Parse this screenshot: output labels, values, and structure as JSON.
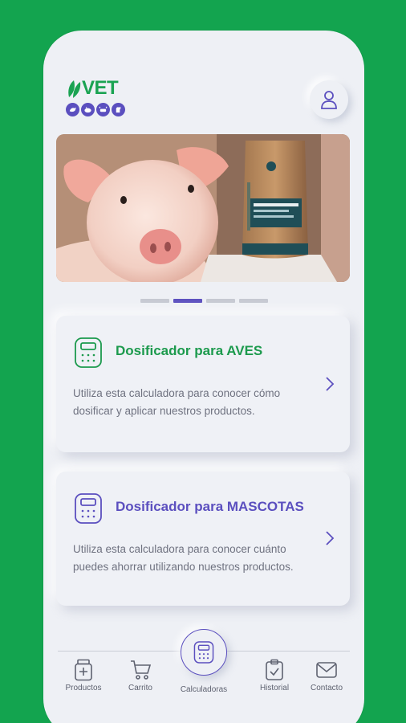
{
  "header": {
    "logo_text": "VET",
    "logo_animals": [
      "bird-icon",
      "pig-icon",
      "cow-icon",
      "dog-icon"
    ],
    "profile_icon": "user-icon"
  },
  "banner": {
    "image": "pig-with-product-bag",
    "slides_total": 4,
    "active_slide": 2
  },
  "cards": [
    {
      "title": "Dosificador para AVES",
      "description": "Utiliza esta calculadora para conocer cómo dosificar y aplicar nuestros productos.",
      "icon": "calculator-icon",
      "accent": "#1c9a4d"
    },
    {
      "title": "Dosificador para MASCOTAS",
      "description": "Utiliza esta calculadora para conocer cuánto puedes ahorrar utilizando nuestros productos.",
      "icon": "calculator-icon",
      "accent": "#5b4fbf"
    }
  ],
  "nav": {
    "items": [
      {
        "label": "Productos",
        "icon": "medicine-jar-icon"
      },
      {
        "label": "Carrito",
        "icon": "cart-icon"
      },
      {
        "label": "Calculadoras",
        "icon": "calculator-icon"
      },
      {
        "label": "Historial",
        "icon": "clipboard-icon"
      },
      {
        "label": "Contacto",
        "icon": "mail-icon"
      }
    ]
  },
  "colors": {
    "background": "#13a44f",
    "brand_green": "#1aa352",
    "brand_purple": "#5b4fbf",
    "screen": "#eef0f5"
  }
}
